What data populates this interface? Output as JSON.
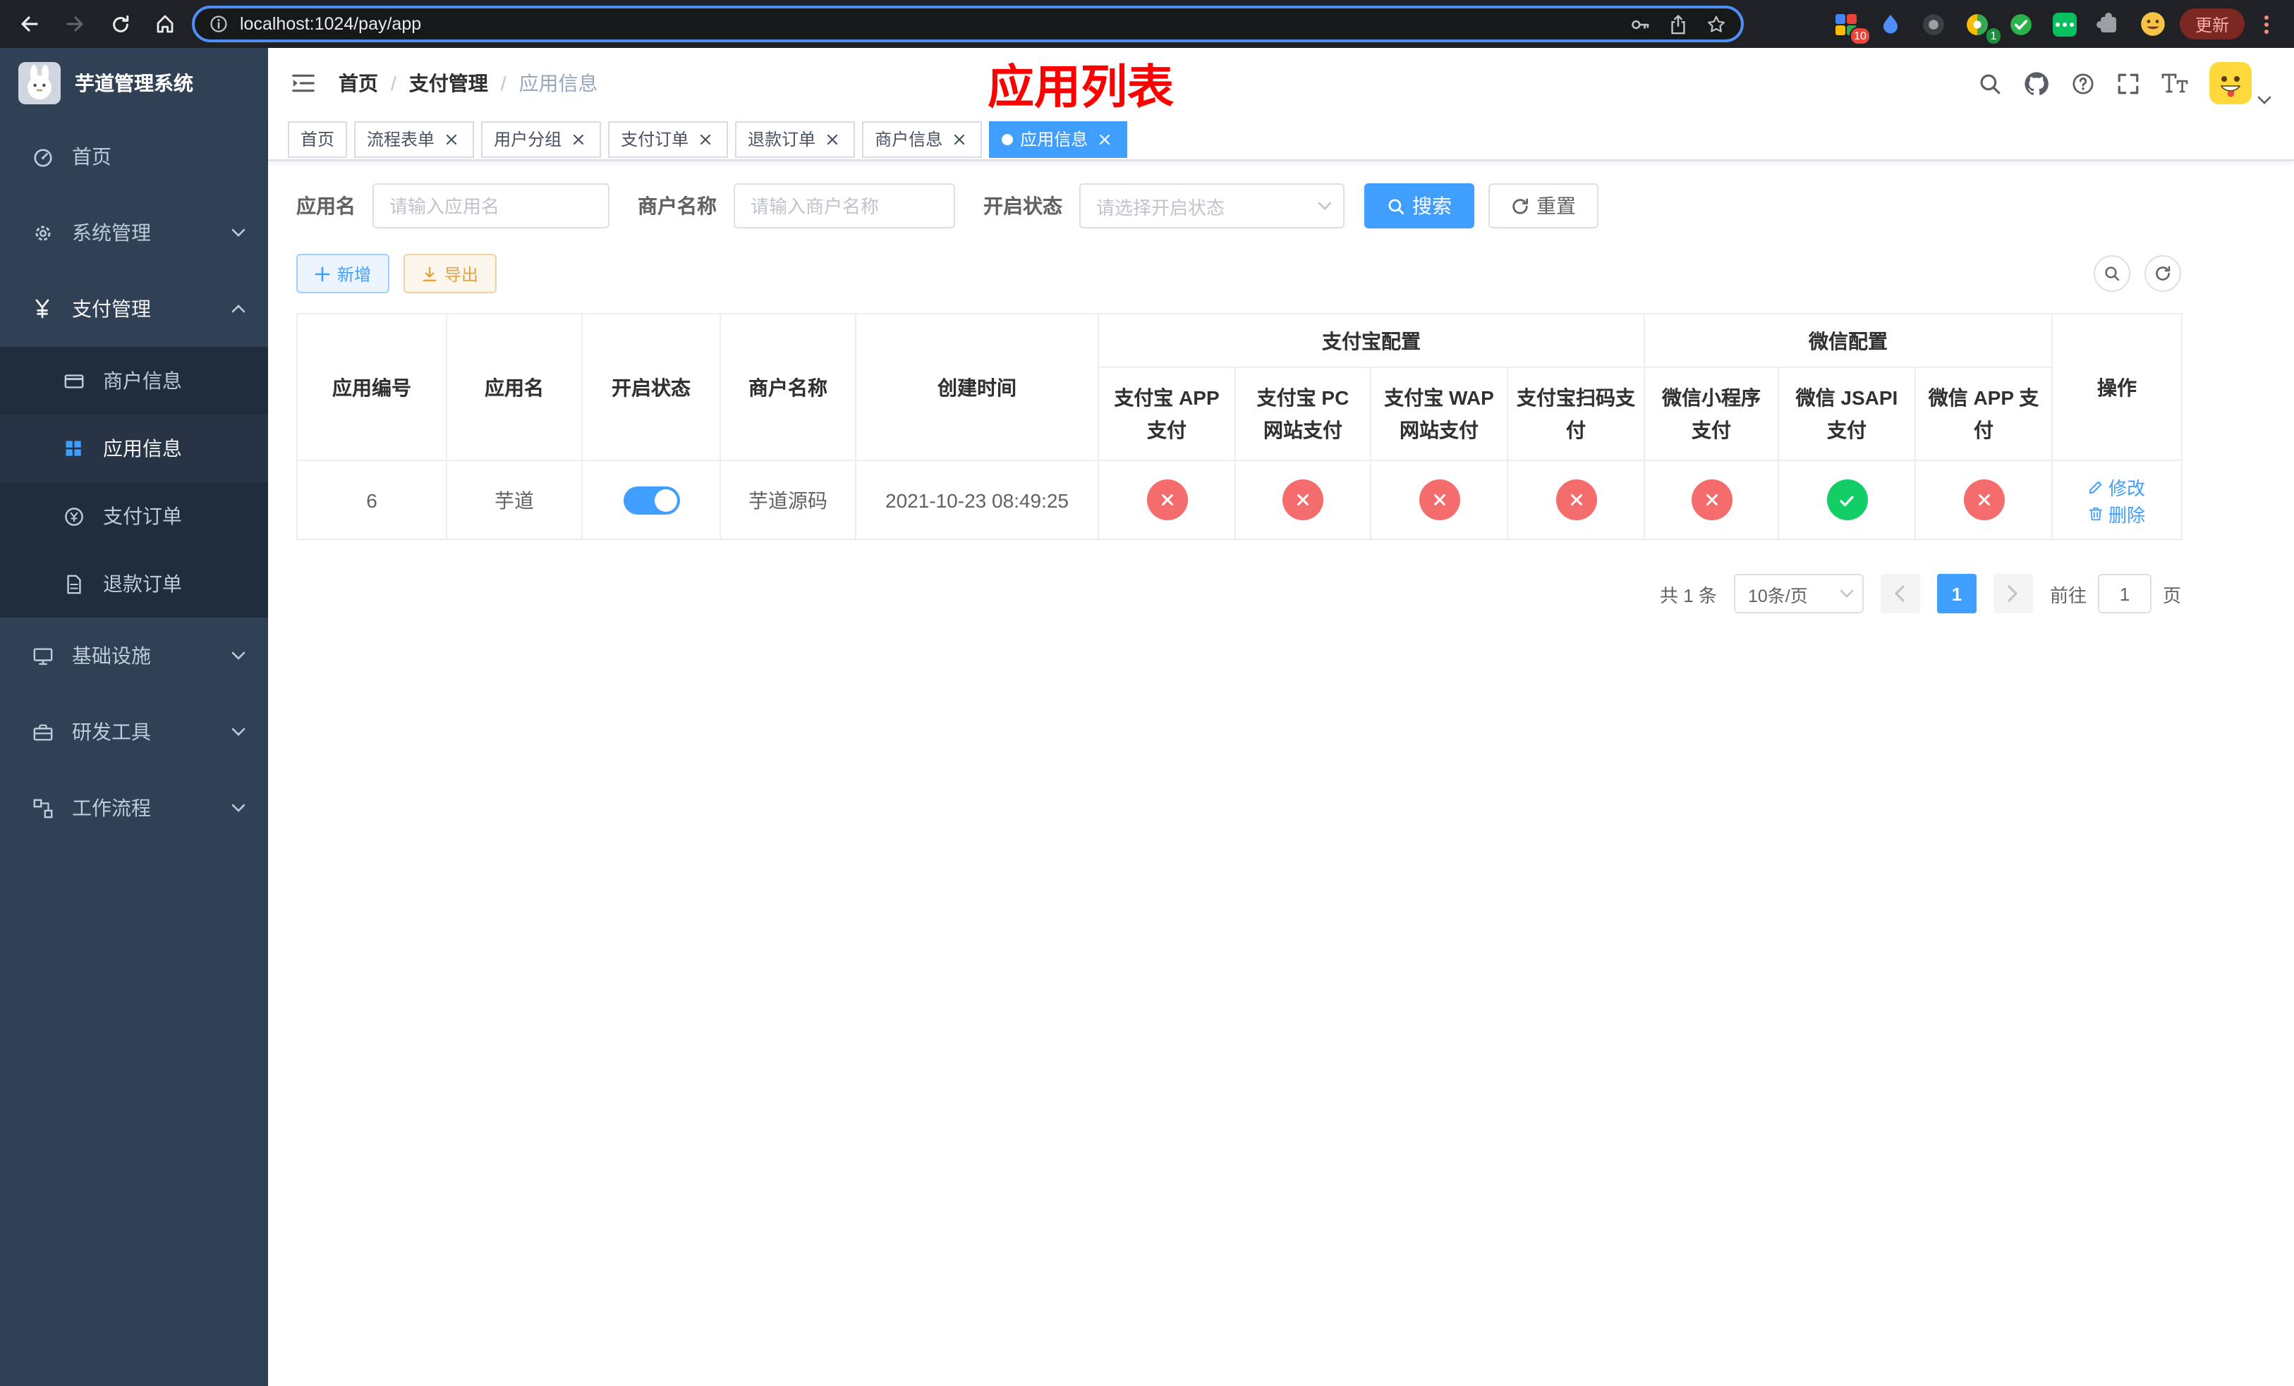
{
  "colors": {
    "primary": "#409eff",
    "success": "#13ce66",
    "danger": "#f56c6c",
    "sidebar_bg": "#304156",
    "annotation": "#ff0000"
  },
  "browser": {
    "url": "localhost:1024/pay/app",
    "update_label": "更新",
    "badges": {
      "grid": "10",
      "circle": "1"
    }
  },
  "sidebar": {
    "title": "芋道管理系统",
    "menu": [
      {
        "label": "首页"
      },
      {
        "label": "系统管理"
      },
      {
        "label": "支付管理"
      },
      {
        "label": "基础设施"
      },
      {
        "label": "研发工具"
      },
      {
        "label": "工作流程"
      }
    ],
    "submenu": [
      {
        "label": "商户信息",
        "active": false
      },
      {
        "label": "应用信息",
        "active": true
      },
      {
        "label": "支付订单",
        "active": false
      },
      {
        "label": "退款订单",
        "active": false
      }
    ]
  },
  "navbar": {
    "breadcrumb": [
      "首页",
      "支付管理",
      "应用信息"
    ],
    "annotation": "应用列表"
  },
  "tabs": [
    {
      "label": "首页",
      "closable": false,
      "active": false
    },
    {
      "label": "流程表单",
      "closable": true,
      "active": false
    },
    {
      "label": "用户分组",
      "closable": true,
      "active": false
    },
    {
      "label": "支付订单",
      "closable": true,
      "active": false
    },
    {
      "label": "退款订单",
      "closable": true,
      "active": false
    },
    {
      "label": "商户信息",
      "closable": true,
      "active": false
    },
    {
      "label": "应用信息",
      "closable": true,
      "active": true
    }
  ],
  "filters": {
    "app_name_label": "应用名",
    "app_name_placeholder": "请输入应用名",
    "merchant_label": "商户名称",
    "merchant_placeholder": "请输入商户名称",
    "status_label": "开启状态",
    "status_placeholder": "请选择开启状态",
    "search_label": "搜索",
    "reset_label": "重置"
  },
  "toolbar": {
    "add_label": "新增",
    "export_label": "导出"
  },
  "table": {
    "headers": {
      "app_id": "应用编号",
      "app_name": "应用名",
      "status": "开启状态",
      "merchant": "商户名称",
      "created": "创建时间",
      "alipay_group": "支付宝配置",
      "wechat_group": "微信配置",
      "actions": "操作",
      "alipay_app": "支付宝 APP 支付",
      "alipay_pc": "支付宝 PC 网站支付",
      "alipay_wap": "支付宝 WAP 网站支付",
      "alipay_qr": "支付宝扫码支付",
      "wx_mini": "微信小程序支付",
      "wx_jsapi": "微信 JSAPI 支付",
      "wx_app": "微信 APP 支付"
    },
    "rows": [
      {
        "app_id": "6",
        "app_name": "芋道",
        "status_on": true,
        "merchant": "芋道源码",
        "created": "2021-10-23 08:49:25",
        "channels": [
          false,
          false,
          false,
          false,
          false,
          true,
          false
        ],
        "edit_label": "修改",
        "delete_label": "删除"
      }
    ]
  },
  "pagination": {
    "total_text": "共 1 条",
    "page_size": "10条/页",
    "current_page": "1",
    "goto_prefix": "前往",
    "goto_value": "1",
    "goto_suffix": "页"
  }
}
